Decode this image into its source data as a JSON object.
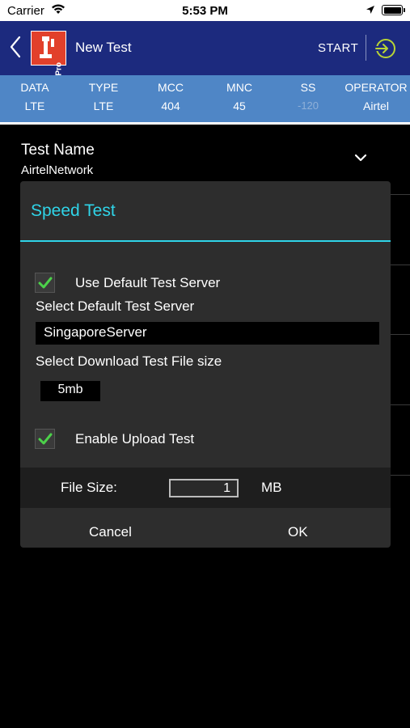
{
  "status_bar": {
    "carrier": "Carrier",
    "time": "5:53 PM"
  },
  "nav": {
    "title": "New Test",
    "start_label": "START",
    "logo_badge": "Pro"
  },
  "info_bar": [
    {
      "header": "DATA",
      "value": "LTE",
      "dim": false
    },
    {
      "header": "TYPE",
      "value": "LTE",
      "dim": false
    },
    {
      "header": "MCC",
      "value": "404",
      "dim": false
    },
    {
      "header": "MNC",
      "value": "45",
      "dim": false
    },
    {
      "header": "SS",
      "value": "-120",
      "dim": true
    },
    {
      "header": "OPERATOR",
      "value": "Airtel",
      "dim": false
    }
  ],
  "form": {
    "test_name_label": "Test Name",
    "test_name_value": "AirtelNetwork"
  },
  "dialog": {
    "title": "Speed Test",
    "use_default_server": {
      "label": "Use Default Test Server",
      "checked": true
    },
    "select_server_label": "Select Default Test Server",
    "server_value": "SingaporeServer",
    "select_size_label": "Select Download Test File size",
    "size_value": "5mb",
    "enable_upload": {
      "label": "Enable Upload Test",
      "checked": true
    },
    "file_size_label": "File Size:",
    "file_size_value": "1",
    "file_size_unit": "MB",
    "cancel_label": "Cancel",
    "ok_label": "OK"
  },
  "colors": {
    "nav_bg": "#1c2a7e",
    "info_bar_bg": "#4f86c6",
    "accent_cyan": "#2fd4e8",
    "check_green": "#4cd14a",
    "logo_red": "#e2402b",
    "enter_icon_green": "#b8d435"
  },
  "icons": [
    "wifi-icon",
    "location-arrow-icon",
    "battery-icon",
    "back-chevron-icon",
    "app-logo-icon",
    "enter-icon",
    "chevron-down-icon",
    "checkmark-icon"
  ]
}
